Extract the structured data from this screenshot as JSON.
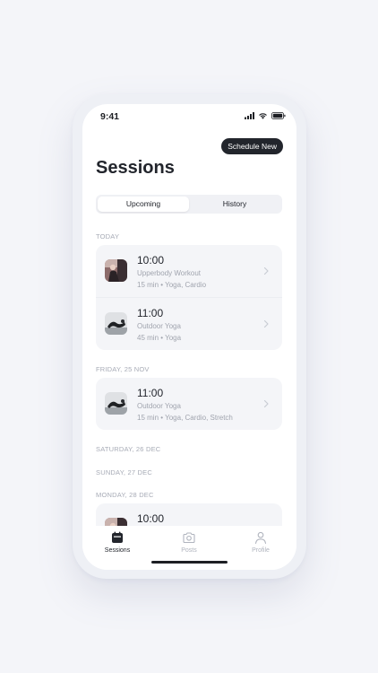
{
  "status_bar": {
    "time": "9:41"
  },
  "header": {
    "schedule_button": "Schedule New",
    "title": "Sessions"
  },
  "tabs_segment": {
    "upcoming": "Upcoming",
    "history": "History"
  },
  "sections": {
    "today": {
      "label": "TODAY",
      "items": [
        {
          "time": "10:00",
          "title": "Upperbody Workout",
          "meta": "15 min • Yoga, Cardio",
          "thumb": "workout-thumbnail"
        },
        {
          "time": "11:00",
          "title": "Outdoor Yoga",
          "meta": "45 min • Yoga",
          "thumb": "yoga-thumbnail"
        }
      ]
    },
    "friday": {
      "label": "FRIDAY, 25 NOV",
      "items": [
        {
          "time": "11:00",
          "title": "Outdoor Yoga",
          "meta": "15 min • Yoga, Cardio, Stretch",
          "thumb": "yoga-thumbnail"
        }
      ]
    },
    "saturday": {
      "label": "SATURDAY, 26 DEC"
    },
    "sunday": {
      "label": "SUNDAY, 27 DEC"
    },
    "monday": {
      "label": "MONDAY, 28 DEC",
      "items": [
        {
          "time": "10:00",
          "thumb": "workout-thumbnail"
        }
      ]
    }
  },
  "tab_bar": {
    "sessions": {
      "label": "Sessions",
      "icon": "calendar-icon"
    },
    "posts": {
      "label": "Posts",
      "icon": "camera-icon"
    },
    "profile": {
      "label": "Profile",
      "icon": "person-icon"
    }
  },
  "colors": {
    "accent_dark": "#22252c",
    "muted_text": "#a0a4ae",
    "card_bg": "#f4f5f8"
  }
}
